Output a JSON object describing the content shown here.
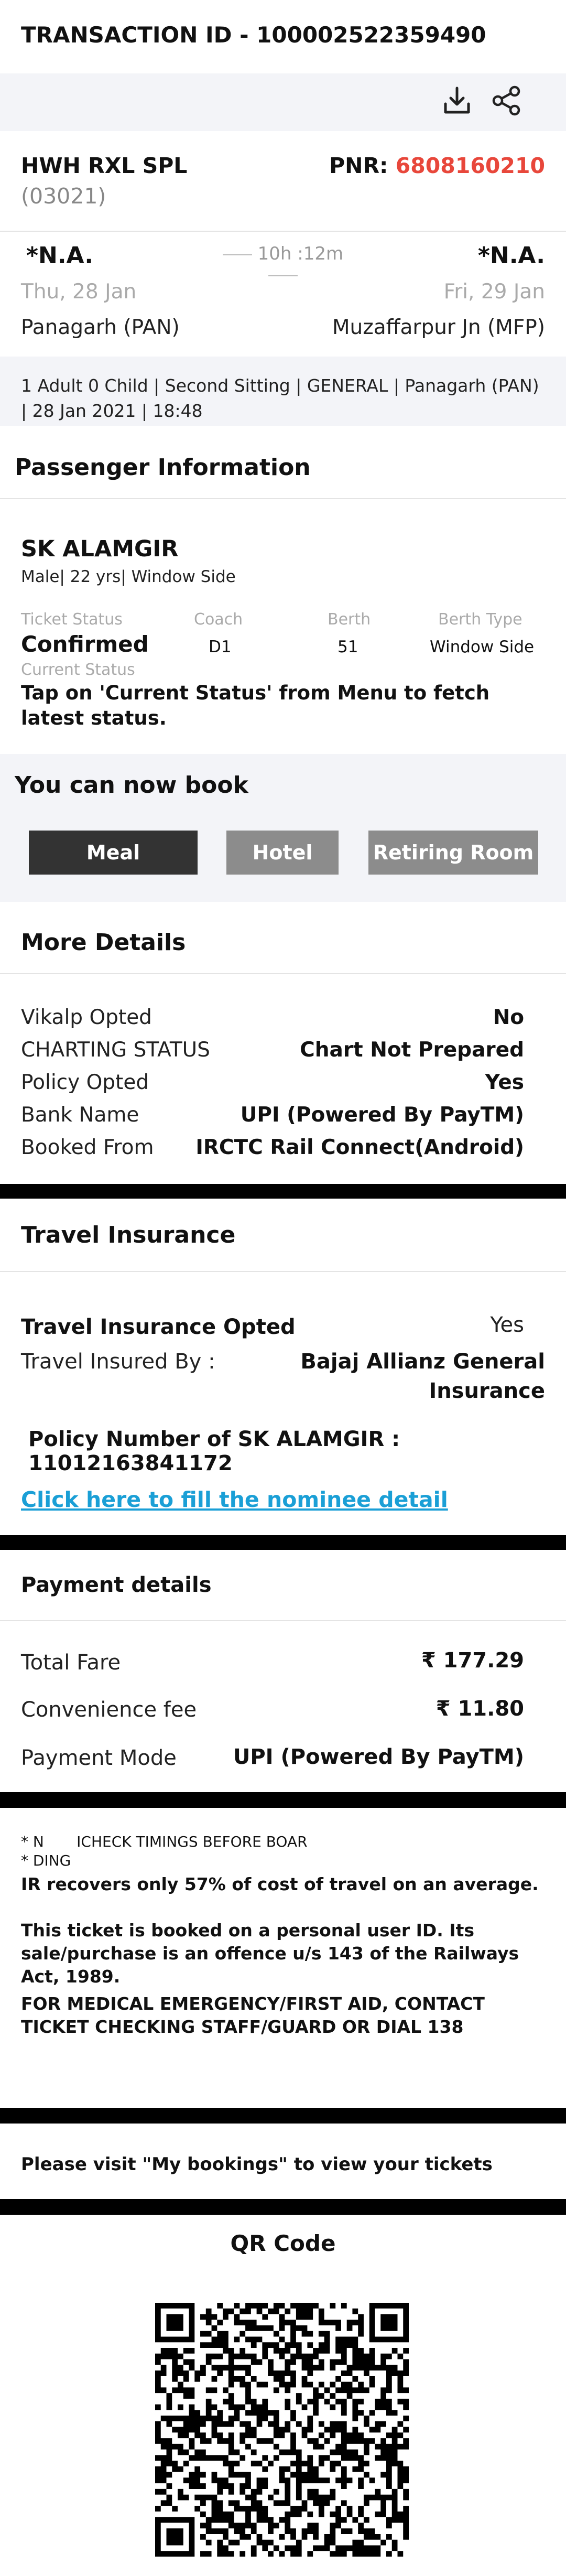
{
  "header": {
    "transaction_id": "TRANSACTION ID - 100002522359490"
  },
  "toolbar": {
    "download_icon": "download-icon",
    "share_icon": "share-icon"
  },
  "train": {
    "name": "HWH RXL SPL",
    "number": "(03021)",
    "pnr_label": "PNR:",
    "pnr": "6808160210",
    "pnr_color": "#e8473b"
  },
  "journey": {
    "dep_time": "*N.A.",
    "arr_time": "*N.A.",
    "duration": "10h :12m",
    "dep_date": "Thu, 28 Jan",
    "arr_date": "Fri, 29 Jan",
    "from_station": "Panagarh (PAN)",
    "to_station": "Muzaffarpur Jn (MFP)",
    "summary": "1 Adult 0 Child | Second Sitting | GENERAL | Panagarh (PAN) | 28 Jan 2021 | 18:48"
  },
  "passenger": {
    "section_title": "Passenger Information",
    "name": "SK ALAMGIR",
    "details": "Male| 22 yrs| Window Side",
    "ticket_status_label": "Ticket Status",
    "ticket_status": "Confirmed",
    "coach_label": "Coach",
    "coach": "D1",
    "berth_label": "Berth",
    "berth": "51",
    "berth_type_label": "Berth Type",
    "berth_type": "Window Side",
    "current_status_label": "Current Status",
    "current_status": "Tap on 'Current Status' from Menu to fetch latest status."
  },
  "book": {
    "title": "You can now book",
    "meal": "Meal",
    "hotel": "Hotel",
    "retiring": "Retiring Room"
  },
  "more": {
    "title": "More Details",
    "rows": [
      {
        "label": "Vikalp Opted",
        "value": "No"
      },
      {
        "label": "CHARTING STATUS",
        "value": "Chart Not Prepared"
      },
      {
        "label": "Policy Opted",
        "value": "Yes"
      },
      {
        "label": "Bank Name",
        "value": "UPI (Powered By PayTM)"
      },
      {
        "label": "Booked From",
        "value": "IRCTC Rail Connect(Android)"
      }
    ]
  },
  "insurance": {
    "title": "Travel Insurance",
    "opted_label": "Travel Insurance Opted",
    "opted_value": "Yes",
    "insured_by_label": "Travel Insured By :",
    "insured_by_line1": "Bajaj Allianz General",
    "insured_by_line2": "Insurance",
    "policy": "Policy Number of SK ALAMGIR : 11012163841172",
    "nominee_link": "Click here to fill the nominee detail",
    "link_color": "#1a9fd6"
  },
  "payment": {
    "title": "Payment details",
    "rows": [
      {
        "label": "Total Fare",
        "value": "₹ 177.29"
      },
      {
        "label": "Convenience fee",
        "value": "₹  11.80"
      },
      {
        "label": "Payment Mode",
        "value": "UPI (Powered By PayTM)"
      }
    ]
  },
  "notes": {
    "small1": "* N       ICHECK TIMINGS BEFORE BOAR",
    "small2": "* DING",
    "line1": "IR recovers only 57% of cost of travel on an average.",
    "line2": "This ticket is booked on a personal user ID. Its sale/purchase is an offence u/s 143 of the Railways Act, 1989.",
    "line3": "FOR MEDICAL EMERGENCY/FIRST AID, CONTACT TICKET CHECKING STAFF/GUARD OR DIAL 138"
  },
  "bookings": {
    "text": "Please visit \"My bookings\" to view your tickets"
  },
  "qr": {
    "title": "QR Code"
  }
}
